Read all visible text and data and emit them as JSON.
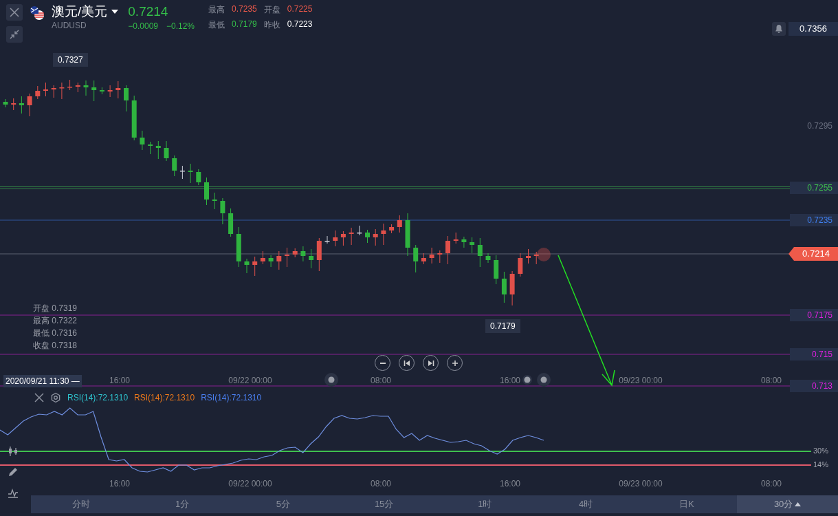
{
  "header": {
    "pair": "澳元/美元",
    "symbol": "AUDUSD",
    "price": "0.7214",
    "change": "−0.0009",
    "change_pct": "−0.12%",
    "stats": [
      {
        "label": "最高",
        "value": "0.7235",
        "color": "#ee5a4a"
      },
      {
        "label": "开盘",
        "value": "0.7225",
        "color": "#ee5a4a"
      },
      {
        "label": "最低",
        "value": "0.7179",
        "color": "#35c04a"
      },
      {
        "label": "昨收",
        "value": "0.7223",
        "color": "#ffffff"
      }
    ]
  },
  "price_axis": {
    "top_value": "0.7356",
    "labels": [
      {
        "text": "0.7295",
        "kind": "plain",
        "color": "#6b7080"
      },
      {
        "text": "0.7255",
        "kind": "double",
        "color": "#3fc04e"
      },
      {
        "text": "0.7235",
        "kind": "line",
        "color": "#3f7ff0"
      },
      {
        "text": "0.7214",
        "kind": "current",
        "color": "#ee5a4a"
      },
      {
        "text": "0.7175",
        "kind": "line",
        "color": "#e020e0"
      },
      {
        "text": "0.715",
        "kind": "line",
        "color": "#e020e0"
      },
      {
        "text": "0.713",
        "kind": "line",
        "color": "#e020e0"
      }
    ]
  },
  "callouts": [
    {
      "text": "0.7327",
      "kind": "high"
    },
    {
      "text": "0.7179",
      "kind": "low"
    }
  ],
  "ohlc": [
    {
      "label": "开盘",
      "value": "0.7319"
    },
    {
      "label": "最高",
      "value": "0.7322"
    },
    {
      "label": "最低",
      "value": "0.7316"
    },
    {
      "label": "收盘",
      "value": "0.7318"
    }
  ],
  "crosshair_time": "2020/09/21 11:30 —",
  "time_axis": [
    "16:00",
    "09/22 00:00",
    "08:00",
    "16:00",
    "09/23 00:00",
    "08:00"
  ],
  "rsi": {
    "legend": [
      {
        "text": "RSI(14):72.1310",
        "color": "#2ec4cf"
      },
      {
        "text": "RSI(14):72.1310",
        "color": "#f07a1a"
      },
      {
        "text": "RSI(14):72.1310",
        "color": "#4a7ff0"
      }
    ],
    "levels": [
      {
        "text": "30%",
        "color": "#3fc04e"
      },
      {
        "text": "14%",
        "color": "#e05a6a"
      }
    ],
    "time_axis": [
      "16:00",
      "09/22 00:00",
      "08:00",
      "16:00",
      "09/23 00:00",
      "08:00"
    ]
  },
  "timeframes": [
    {
      "label": "分时",
      "selected": false
    },
    {
      "label": "1分",
      "selected": false
    },
    {
      "label": "5分",
      "selected": false
    },
    {
      "label": "15分",
      "selected": false
    },
    {
      "label": "1时",
      "selected": false
    },
    {
      "label": "4时",
      "selected": false
    },
    {
      "label": "日K",
      "selected": false
    },
    {
      "label": "30分",
      "selected": true
    }
  ]
}
